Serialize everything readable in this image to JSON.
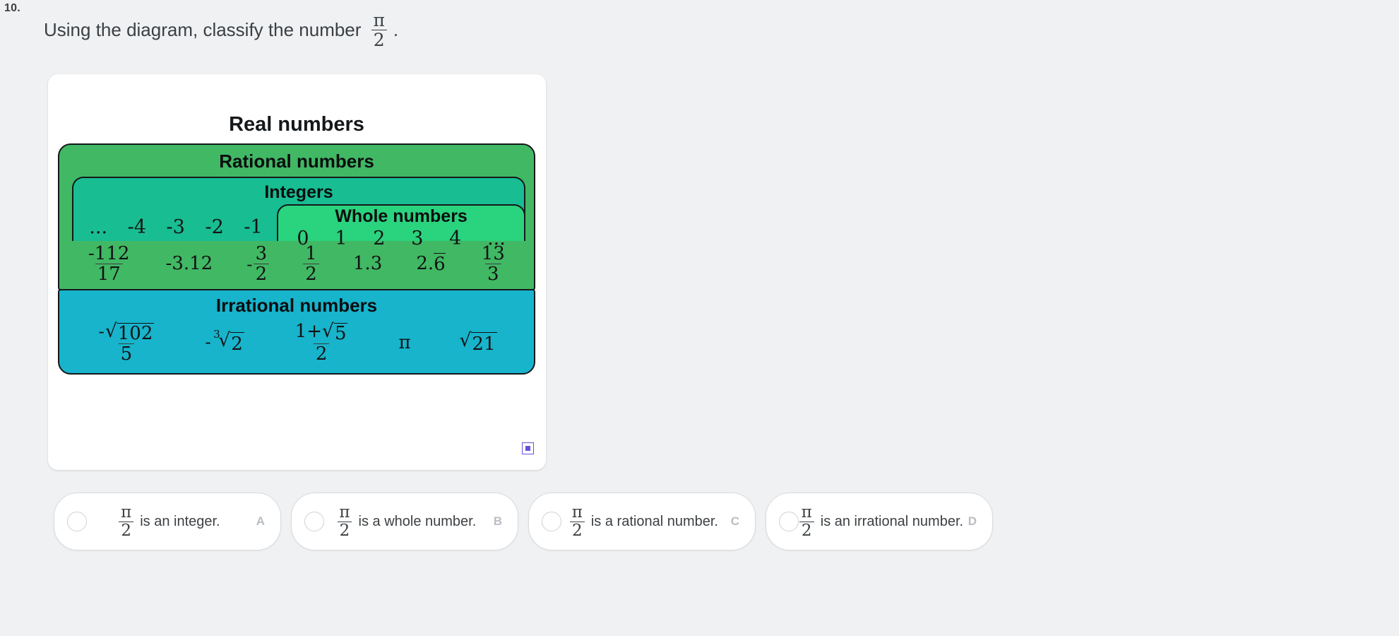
{
  "question": {
    "number": "10.",
    "lead_text": "Using the diagram, classify the number",
    "value_numerator": "π",
    "value_denominator": "2",
    "trailing_punctuation": "."
  },
  "diagram": {
    "title": "Real numbers",
    "expand_icon": "expand-diagram-icon",
    "colors": {
      "rational": "#41b864",
      "integers": "#18bd92",
      "whole": "#2ad37e",
      "irrational": "#17b4cc",
      "outline": "#15181b",
      "card": "#ffffff",
      "page_background": "#eff1f3"
    },
    "rational": {
      "title": "Rational numbers",
      "examples": [
        {
          "type": "fraction",
          "numerator": "-112",
          "denominator": "17"
        },
        {
          "type": "plain",
          "text": "-3.12"
        },
        {
          "type": "signed_fraction",
          "sign": "-",
          "numerator": "3",
          "denominator": "2"
        },
        {
          "type": "fraction",
          "numerator": "1",
          "denominator": "2"
        },
        {
          "type": "plain",
          "text": "1.3"
        },
        {
          "type": "repeating",
          "text": "2.6",
          "repeating_digit": "6"
        },
        {
          "type": "fraction",
          "numerator": "13",
          "denominator": "3"
        }
      ]
    },
    "integers": {
      "title": "Integers",
      "negative_values": [
        "...",
        "-4",
        "-3",
        "-2",
        "-1"
      ]
    },
    "whole_numbers": {
      "title": "Whole numbers",
      "values": [
        "0",
        "1",
        "2",
        "3",
        "4",
        "..."
      ]
    },
    "irrational": {
      "title": "Irrational numbers",
      "examples": [
        {
          "type": "radical_fraction",
          "sign": "-",
          "radicand": "102",
          "denominator": "5"
        },
        {
          "type": "cube_root",
          "sign": "-",
          "index": "3",
          "radicand": "2"
        },
        {
          "type": "golden_ratio",
          "numerator_left": "1+",
          "radicand": "5",
          "denominator": "2"
        },
        {
          "type": "symbol",
          "text": "π"
        },
        {
          "type": "radical",
          "radicand": "21"
        }
      ]
    }
  },
  "options": [
    {
      "letter": "A",
      "numerator": "π",
      "denominator": "2",
      "text": "is an integer.",
      "selected": false
    },
    {
      "letter": "B",
      "numerator": "π",
      "denominator": "2",
      "text": "is a whole number.",
      "selected": false
    },
    {
      "letter": "C",
      "numerator": "π",
      "denominator": "2",
      "text": "is a rational number.",
      "selected": false
    },
    {
      "letter": "D",
      "numerator": "π",
      "denominator": "2",
      "text": "is an irrational number.",
      "selected": false
    }
  ]
}
